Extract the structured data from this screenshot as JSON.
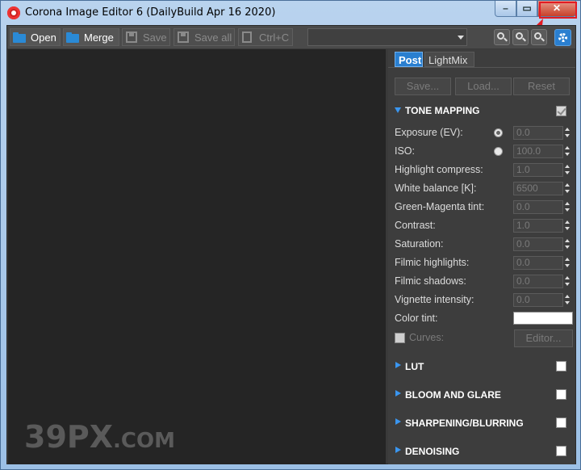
{
  "window": {
    "title": "Corona Image Editor 6 (DailyBuild Apr 16 2020)",
    "minimize_glyph": "–",
    "maximize_glyph": "▭",
    "close_glyph": "✕"
  },
  "toolbar": {
    "open_label": "Open",
    "merge_label": "Merge",
    "save_label": "Save",
    "save_all_label": "Save all",
    "copy_label": "Ctrl+C",
    "combo_value": ""
  },
  "panel": {
    "tabs": [
      {
        "label": "Post",
        "active": true
      },
      {
        "label": "LightMix",
        "active": false
      }
    ],
    "actions": {
      "save": "Save...",
      "load": "Load...",
      "reset": "Reset"
    },
    "tone_mapping": {
      "title": "TONE MAPPING",
      "checked": true,
      "params": [
        {
          "label": "Exposure (EV):",
          "value": "0.0"
        },
        {
          "label": "ISO:",
          "value": "100.0"
        },
        {
          "label": "Highlight compress:",
          "value": "1.0"
        },
        {
          "label": "White balance [K]:",
          "value": "6500"
        },
        {
          "label": "Green-Magenta tint:",
          "value": "0.0"
        },
        {
          "label": "Contrast:",
          "value": "1.0"
        },
        {
          "label": "Saturation:",
          "value": "0.0"
        },
        {
          "label": "Filmic highlights:",
          "value": "0.0"
        },
        {
          "label": "Filmic shadows:",
          "value": "0.0"
        },
        {
          "label": "Vignette intensity:",
          "value": "0.0"
        }
      ],
      "color_tint_label": "Color tint:",
      "color_tint_value": "#ffffff",
      "curves_label": "Curves:",
      "editor_label": "Editor..."
    },
    "sections": [
      {
        "title": "LUT"
      },
      {
        "title": "BLOOM AND GLARE"
      },
      {
        "title": "SHARPENING/BLURRING"
      },
      {
        "title": "DENOISING"
      }
    ]
  },
  "watermark": {
    "big": "39PX",
    "small": ".COM"
  },
  "colors": {
    "accent": "#2a7fd0",
    "highlight_red": "#e31b23"
  }
}
